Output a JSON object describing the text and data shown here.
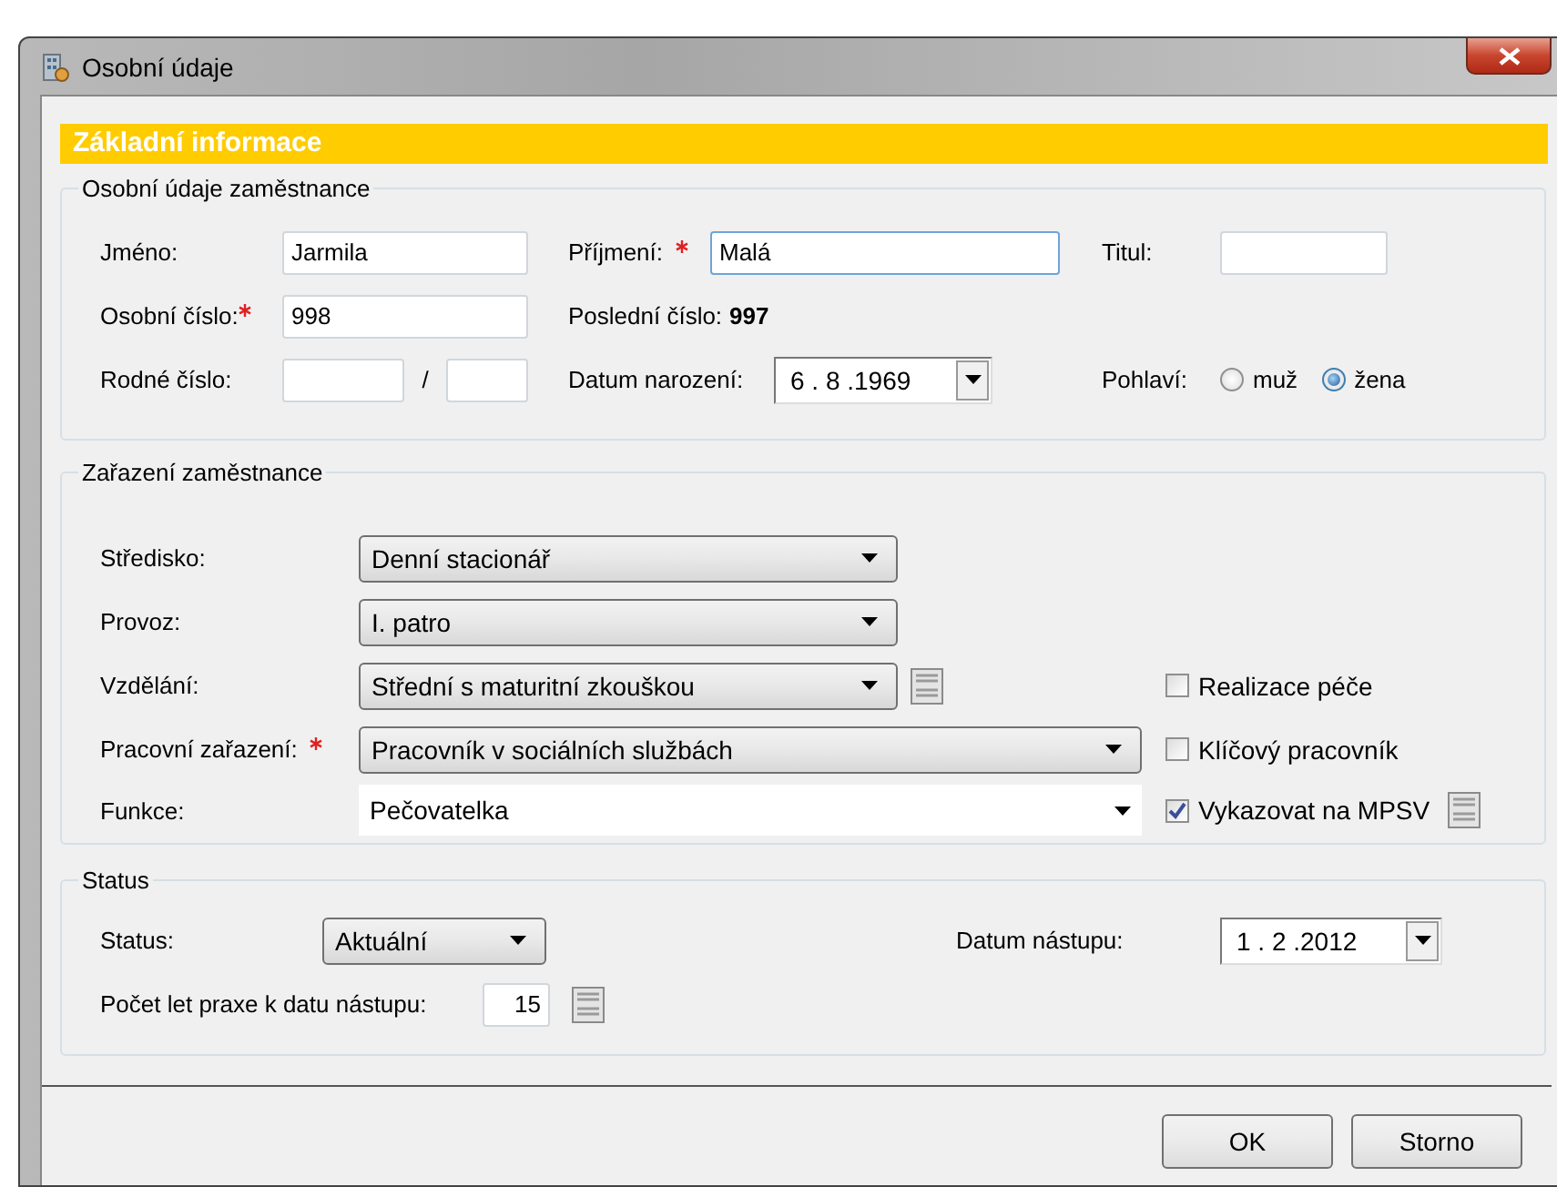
{
  "window": {
    "title": "Osobní údaje"
  },
  "header": "Základní informace",
  "personal": {
    "title": "Osobní údaje zaměstnance",
    "first_name": {
      "label": "Jméno:",
      "value": "Jarmila",
      "focused": false
    },
    "last_name": {
      "label": "Příjmení:",
      "value": "Malá",
      "required": true,
      "focused": true
    },
    "degree": {
      "label": "Titul:",
      "focused": false
    },
    "personal_number": {
      "label": "Osobní číslo:",
      "value": "998",
      "required": true,
      "focused": false
    },
    "last_number": {
      "label": "Poslední číslo:",
      "value": "997"
    },
    "birth_number": {
      "label": "Rodné číslo:",
      "separator": "/"
    },
    "birth_date": {
      "label": "Datum narození:",
      "value": "6 . 8 .1969"
    },
    "gender": {
      "label": "Pohlaví:",
      "options": [
        {
          "label": "muž",
          "selected": false
        },
        {
          "label": "žena",
          "selected": true
        }
      ]
    }
  },
  "placement": {
    "title": "Zařazení zaměstnance",
    "rows": [
      {
        "label": "Středisko:",
        "required": false,
        "kind": "dropdown",
        "wide": false,
        "value": "Denní stacionář",
        "mpsv_icon": false
      },
      {
        "label": "Provoz:",
        "required": false,
        "kind": "dropdown",
        "wide": false,
        "value": "I. patro",
        "mpsv_icon": false
      },
      {
        "label": "Vzdělání:",
        "required": false,
        "kind": "dropdown",
        "wide": false,
        "value": "Střední s maturitní zkouškou",
        "mpsv_icon": true,
        "option": {
          "label": "Realizace péče",
          "checked": false,
          "mpsv_icon": false
        }
      },
      {
        "label": "Pracovní zařazení:",
        "required": true,
        "kind": "dropdown",
        "wide": true,
        "value": "Pracovník v sociálních službách",
        "mpsv_icon": false,
        "option": {
          "label": "Klíčový pracovník",
          "checked": false,
          "mpsv_icon": false
        }
      },
      {
        "label": "Funkce:",
        "required": false,
        "kind": "combo",
        "wide": true,
        "value": "Pečovatelka",
        "mpsv_icon": false,
        "option": {
          "label": "Vykazovat na MPSV",
          "checked": true,
          "mpsv_icon": true
        }
      }
    ]
  },
  "status": {
    "title": "Status",
    "status": {
      "label": "Status:",
      "value": "Aktuální"
    },
    "start_date": {
      "label": "Datum nástupu:",
      "value": "1 . 2 .2012"
    },
    "practice": {
      "label": "Počet let praxe k datu nástupu:",
      "value": "15",
      "mpsv_icon": true
    }
  },
  "buttons": [
    "OK",
    "Storno"
  ]
}
